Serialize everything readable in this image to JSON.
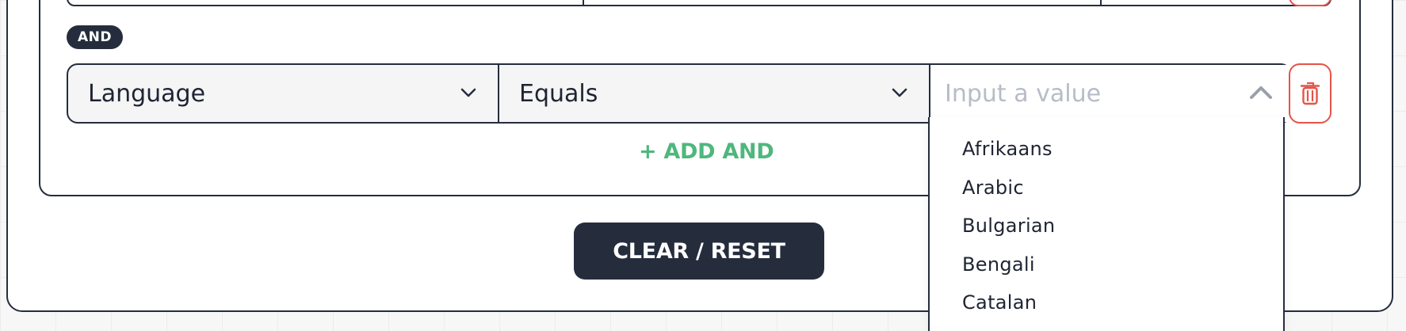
{
  "rule_group": {
    "connector_badge": "AND",
    "rule": {
      "field": "Language",
      "operator": "Equals",
      "value": "",
      "value_placeholder": "Input a value"
    },
    "add_and_label": "+ ADD AND"
  },
  "clear_reset_label": "CLEAR / RESET",
  "dropdown": {
    "options": [
      "Afrikaans",
      "Arabic",
      "Bulgarian",
      "Bengali",
      "Catalan"
    ]
  },
  "icons": {
    "field_chevron": "chevron-down-icon",
    "operator_chevron": "chevron-down-icon",
    "value_chevron": "chevron-up-icon",
    "delete": "trash-icon"
  },
  "colors": {
    "dark": "#252d3d",
    "accent_green": "#4fb77d",
    "danger_red": "#e45447",
    "placeholder": "#b7bcc6"
  }
}
